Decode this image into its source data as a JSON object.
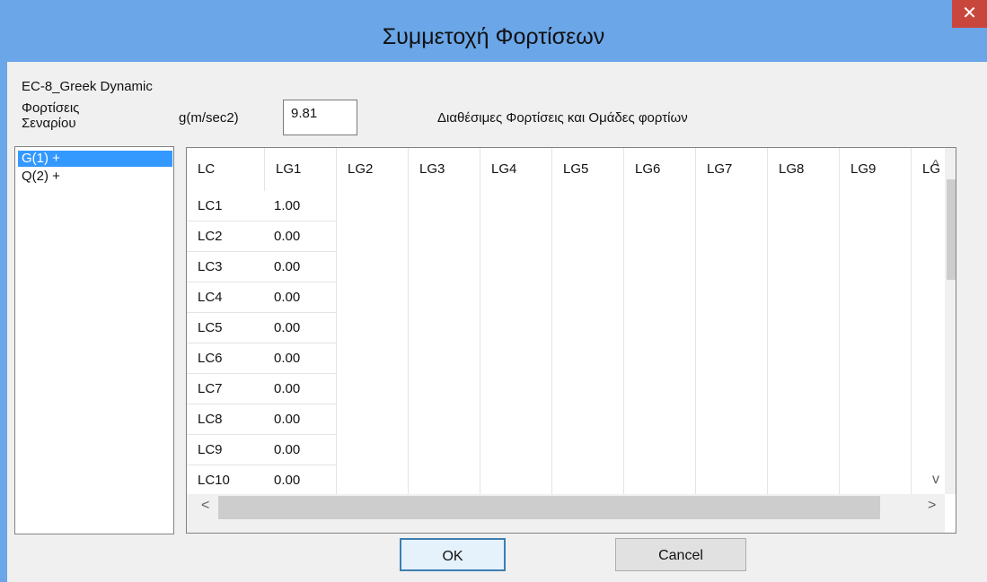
{
  "window": {
    "title": "Συμμετοχή Φορτίσεων",
    "close_glyph": "✕"
  },
  "dialog": {
    "scheme_name": "EC-8_Greek Dynamic",
    "scenario_label_line1": "Φορτίσεις",
    "scenario_label_line2": "Σεναρίου",
    "g_label": "g(m/sec2)",
    "g_value": "9.81",
    "available_label": "Διαθέσιμες Φορτίσεις και Ομάδες φορτίων"
  },
  "scenario_list": [
    {
      "label": "G(1) +",
      "selected": true
    },
    {
      "label": "Q(2) +",
      "selected": false
    }
  ],
  "grid": {
    "headers": [
      "LC",
      "LG1",
      "LG2",
      "LG3",
      "LG4",
      "LG5",
      "LG6",
      "LG7",
      "LG8",
      "LG9",
      "LG"
    ],
    "rows": [
      {
        "lc": "LC1",
        "lg1": "1.00"
      },
      {
        "lc": "LC2",
        "lg1": "0.00"
      },
      {
        "lc": "LC3",
        "lg1": "0.00"
      },
      {
        "lc": "LC4",
        "lg1": "0.00"
      },
      {
        "lc": "LC5",
        "lg1": "0.00"
      },
      {
        "lc": "LC6",
        "lg1": "0.00"
      },
      {
        "lc": "LC7",
        "lg1": "0.00"
      },
      {
        "lc": "LC8",
        "lg1": "0.00"
      },
      {
        "lc": "LC9",
        "lg1": "0.00"
      },
      {
        "lc": "LC10",
        "lg1": "0.00"
      }
    ]
  },
  "scrollbars": {
    "up": "^",
    "down": "v",
    "left": "<",
    "right": ">"
  },
  "buttons": {
    "ok": "OK",
    "cancel": "Cancel"
  }
}
